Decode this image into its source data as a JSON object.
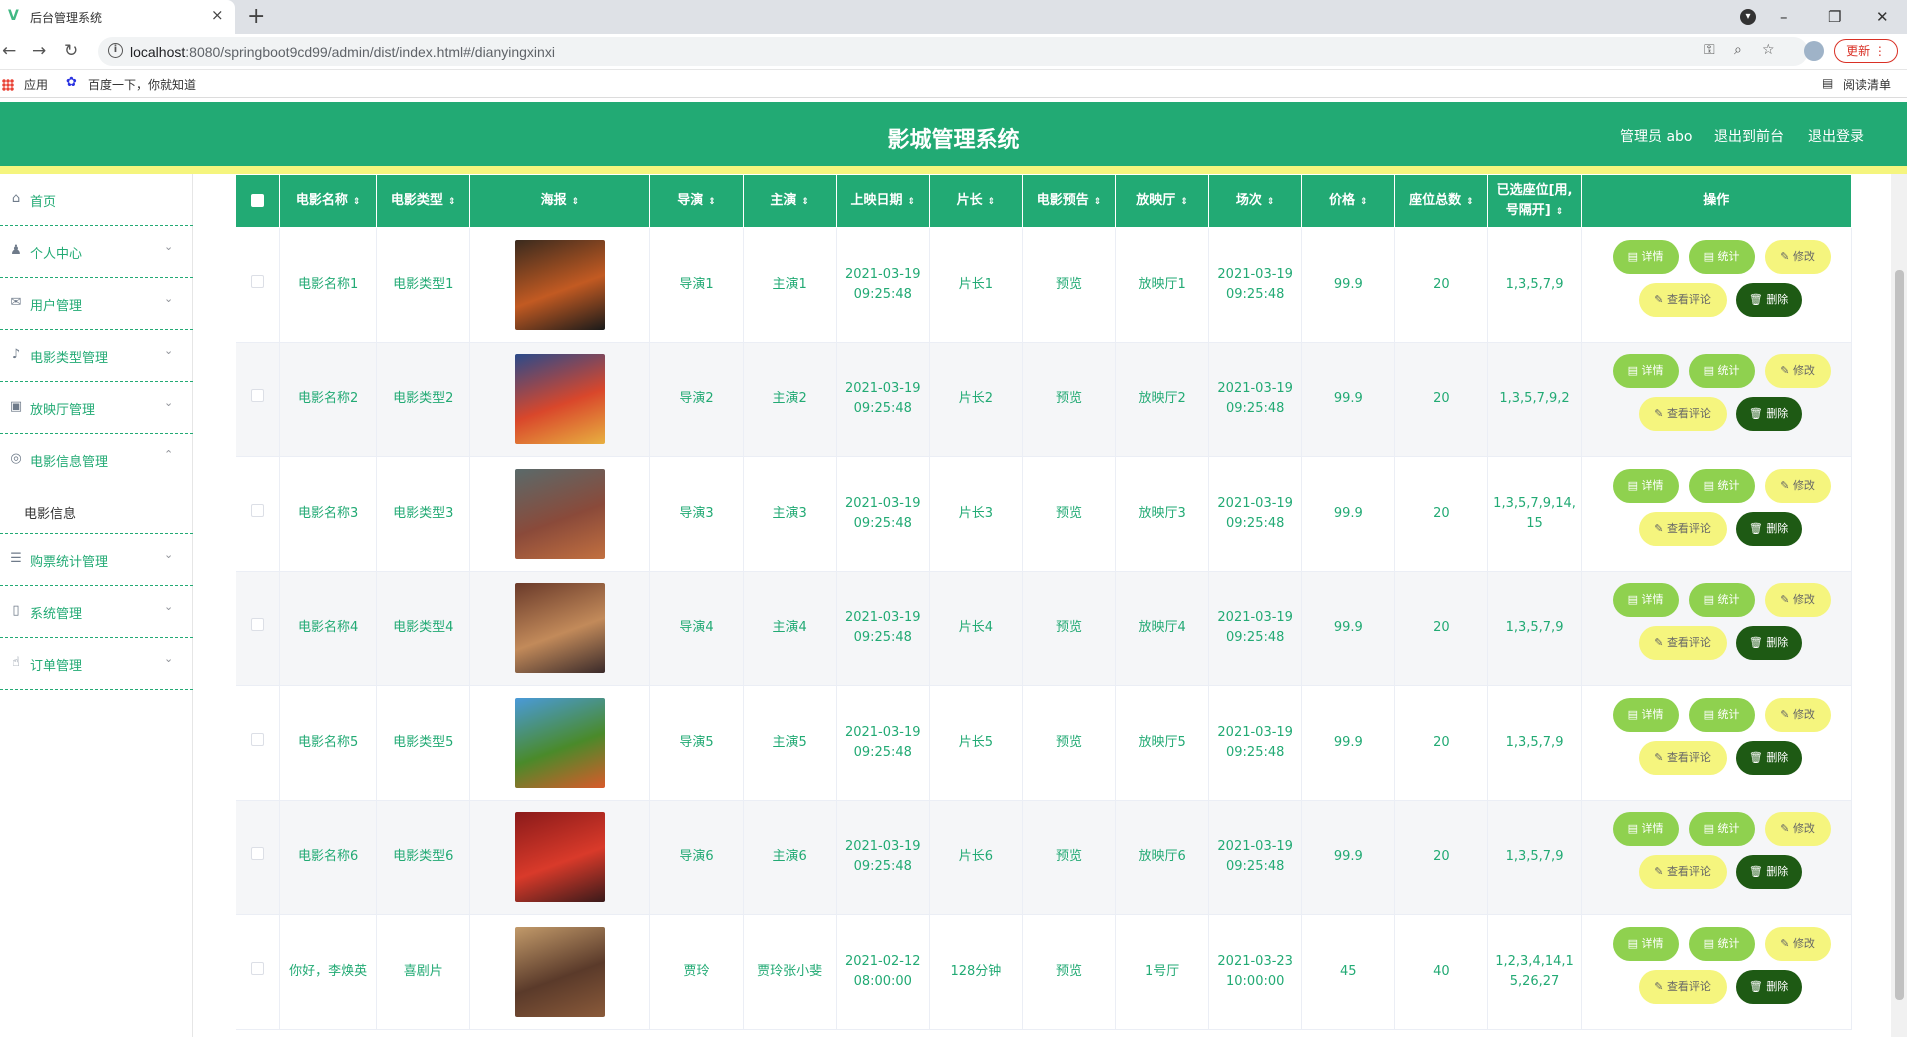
{
  "browser": {
    "tab_title": "后台管理系统",
    "url_host": "localhost",
    "url_rest": ":8080/springboot9cd99/admin/dist/index.html#/dianyingxinxi",
    "update_label": "更新",
    "bookmarks": [
      {
        "label": "应用",
        "icon": "apps-icon"
      },
      {
        "label": "百度一下，你就知道",
        "icon": "baidu-paw-icon"
      }
    ],
    "reading_list": "阅读清单"
  },
  "header": {
    "title": "影城管理系统",
    "admin_label": "管理员 abo",
    "front_link": "退出到前台",
    "logout_link": "退出登录"
  },
  "sidebar": {
    "items": [
      {
        "label": "首页",
        "icon": "home-icon",
        "expand": false
      },
      {
        "label": "个人中心",
        "icon": "user-icon",
        "expand": true
      },
      {
        "label": "用户管理",
        "icon": "mail-icon",
        "expand": true
      },
      {
        "label": "电影类型管理",
        "icon": "mic-icon",
        "expand": true
      },
      {
        "label": "放映厅管理",
        "icon": "briefcase-icon",
        "expand": true
      },
      {
        "label": "电影信息管理",
        "icon": "compass-icon",
        "expand": true,
        "open": true
      },
      {
        "label": "电影信息",
        "sub": true
      },
      {
        "label": "购票统计管理",
        "icon": "sliders-icon",
        "expand": true
      },
      {
        "label": "系统管理",
        "icon": "phone-icon",
        "expand": true
      },
      {
        "label": "订单管理",
        "icon": "thumbs-up-icon",
        "expand": true
      }
    ]
  },
  "table": {
    "columns": [
      "电影名称",
      "电影类型",
      "海报",
      "导演",
      "主演",
      "上映日期",
      "片长",
      "电影预告",
      "放映厅",
      "场次",
      "价格",
      "座位总数",
      "已选座位[用,号隔开]",
      "操作"
    ],
    "buttons": {
      "detail": "详情",
      "stat": "统计",
      "edit": "修改",
      "comment": "查看评论",
      "delete": "删除"
    },
    "rows": [
      {
        "name": "电影名称1",
        "type": "电影类型1",
        "director": "导演1",
        "actor": "主演1",
        "release": "2021-03-19 09:25:48",
        "length": "片长1",
        "trailer": "预览",
        "hall": "放映厅1",
        "session": "2021-03-19 09:25:48",
        "price": "99.9",
        "seats": "20",
        "selected": "1,3,5,7,9",
        "poster_colors": [
          "#3a2a1e",
          "#c25a22",
          "#1a1a1a"
        ]
      },
      {
        "name": "电影名称2",
        "type": "电影类型2",
        "director": "导演2",
        "actor": "主演2",
        "release": "2021-03-19 09:25:48",
        "length": "片长2",
        "trailer": "预览",
        "hall": "放映厅2",
        "session": "2021-03-19 09:25:48",
        "price": "99.9",
        "seats": "20",
        "selected": "1,3,5,7,9,2",
        "poster_colors": [
          "#2b4a8a",
          "#d9472b",
          "#e8b040"
        ]
      },
      {
        "name": "电影名称3",
        "type": "电影类型3",
        "director": "导演3",
        "actor": "主演3",
        "release": "2021-03-19 09:25:48",
        "length": "片长3",
        "trailer": "预览",
        "hall": "放映厅3",
        "session": "2021-03-19 09:25:48",
        "price": "99.9",
        "seats": "20",
        "selected": "1,3,5,7,9,14,15",
        "poster_colors": [
          "#5a6a6a",
          "#8a4a3a",
          "#c27040"
        ]
      },
      {
        "name": "电影名称4",
        "type": "电影类型4",
        "director": "导演4",
        "actor": "主演4",
        "release": "2021-03-19 09:25:48",
        "length": "片长4",
        "trailer": "预览",
        "hall": "放映厅4",
        "session": "2021-03-19 09:25:48",
        "price": "99.9",
        "seats": "20",
        "selected": "1,3,5,7,9",
        "poster_colors": [
          "#6a3a2a",
          "#c28a5a",
          "#3a2a2a"
        ]
      },
      {
        "name": "电影名称5",
        "type": "电影类型5",
        "director": "导演5",
        "actor": "主演5",
        "release": "2021-03-19 09:25:48",
        "length": "片长5",
        "trailer": "预览",
        "hall": "放映厅5",
        "session": "2021-03-19 09:25:48",
        "price": "99.9",
        "seats": "20",
        "selected": "1,3,5,7,9",
        "poster_colors": [
          "#4a9ad9",
          "#4a8a2a",
          "#d95a2a"
        ]
      },
      {
        "name": "电影名称6",
        "type": "电影类型6",
        "director": "导演6",
        "actor": "主演6",
        "release": "2021-03-19 09:25:48",
        "length": "片长6",
        "trailer": "预览",
        "hall": "放映厅6",
        "session": "2021-03-19 09:25:48",
        "price": "99.9",
        "seats": "20",
        "selected": "1,3,5,7,9",
        "poster_colors": [
          "#8a1a1a",
          "#d93a2a",
          "#3a1a1a"
        ]
      },
      {
        "name": "你好，李焕英",
        "type": "喜剧片",
        "director": "贾玲",
        "actor": "贾玲张小斐",
        "release": "2021-02-12 08:00:00",
        "length": "128分钟",
        "trailer": "预览",
        "hall": "1号厅",
        "session": "2021-03-23 10:00:00",
        "price": "45",
        "seats": "40",
        "selected": "1,2,3,4,14,15,26,27",
        "poster_colors": [
          "#c29a6a",
          "#5a3a2a",
          "#8a5a3a"
        ]
      }
    ]
  },
  "colors": {
    "brand": "#22aa74",
    "accent_yellow": "#f5f57e",
    "button_green": "#8fd14f",
    "delete_dark": "#1e5a14"
  }
}
